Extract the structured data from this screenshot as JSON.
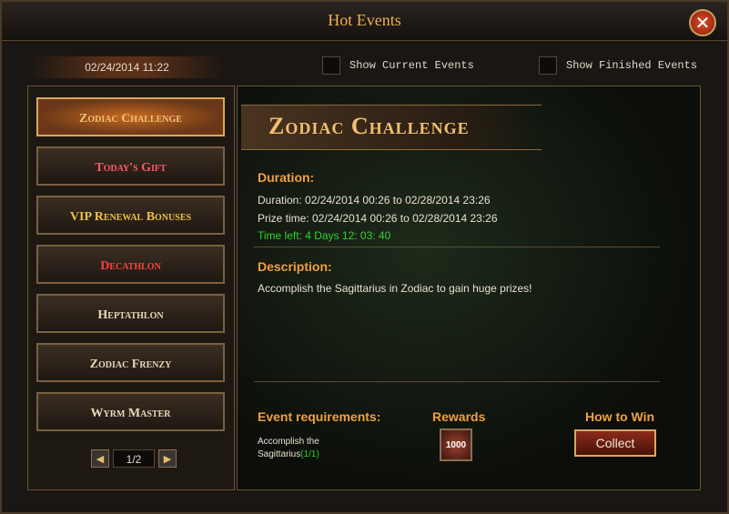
{
  "window": {
    "title": "Hot Events",
    "close_label": "✕"
  },
  "header": {
    "datetime": "02/24/2014 11:22",
    "show_current_label": "Show Current Events",
    "show_finished_label": "Show Finished Events"
  },
  "sidebar": {
    "items": [
      {
        "label": "Zodiac Challenge",
        "color": "#f0c070",
        "active": true
      },
      {
        "label": "Today's Gift",
        "color": "#ff5a6a",
        "active": false
      },
      {
        "label": "VIP Renewal Bonuses",
        "color": "#f0c040",
        "active": false
      },
      {
        "label": "Decathlon",
        "color": "#ff4040",
        "active": false
      },
      {
        "label": "Heptathlon",
        "color": "#e8d8b8",
        "active": false
      },
      {
        "label": "Zodiac Frenzy",
        "color": "#e8d8b8",
        "active": false
      },
      {
        "label": "Wyrm Master",
        "color": "#e8d8b8",
        "active": false
      }
    ],
    "pager": {
      "prev": "◀",
      "page": "1/2",
      "next": "▶"
    }
  },
  "detail": {
    "title": "Zodiac Challenge",
    "duration_heading": "Duration:",
    "duration_line": "Duration: 02/24/2014 00:26 to 02/28/2014 23:26",
    "prize_line": "Prize time: 02/24/2014 00:26 to 02/28/2014 23:26",
    "time_left": "Time left: 4  Days  12: 03: 40",
    "description_heading": "Description:",
    "description": "Accomplish the Sagittarius in Zodiac to gain huge prizes!",
    "requirements_heading": "Event requirements:",
    "requirement_text": "Accomplish the Sagittarius",
    "requirement_progress": "(1/1)",
    "rewards_heading": "Rewards",
    "reward_amount": "1000",
    "how_to_win_heading": "How to Win",
    "collect_label": "Collect"
  }
}
